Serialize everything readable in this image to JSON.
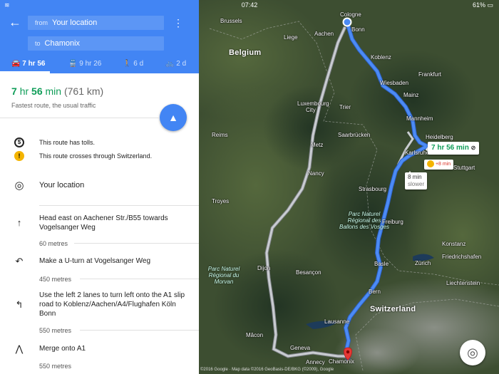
{
  "status": {
    "time": "07:42",
    "battery": "61%"
  },
  "route_form": {
    "from_label": "from",
    "from_value": "Your location",
    "to_label": "to",
    "to_value": "Chamonix"
  },
  "modes": [
    {
      "icon": "car-icon",
      "glyph": "🚘",
      "label": "7 hr 56",
      "selected": true
    },
    {
      "icon": "transit-icon",
      "glyph": "🚆",
      "label": "9 hr 26",
      "selected": false
    },
    {
      "icon": "walk-icon",
      "glyph": "🚶",
      "label": "6 d",
      "selected": false
    },
    {
      "icon": "bike-icon",
      "glyph": "🚲",
      "label": "2 d",
      "selected": false
    }
  ],
  "summary": {
    "hours": "7",
    "hr_label": "hr",
    "minutes": "56",
    "min_label": "min",
    "distance": "(761 km)",
    "subtitle": "Fastest route, the usual traffic"
  },
  "notes": [
    {
      "icon": "toll-icon",
      "text": "This route has tolls."
    },
    {
      "icon": "warning-icon",
      "text": "This route crosses through Switzerland."
    }
  ],
  "origin": {
    "icon": "my-location-icon",
    "text": "Your location"
  },
  "steps": [
    {
      "icon": "straight-arrow-icon",
      "glyph": "↑",
      "text": "Head east on Aachener Str./B55 towards Vogelsanger Weg",
      "distance": "60 metres"
    },
    {
      "icon": "u-turn-icon",
      "glyph": "↶",
      "text": "Make a U-turn at Vogelsanger Weg",
      "distance": "450 metres"
    },
    {
      "icon": "turn-left-icon",
      "glyph": "↰",
      "text": "Use the left 2 lanes to turn left onto the A1 slip road to Koblenz/Aachen/A4/Flughafen Köln Bonn",
      "distance": "550 metres"
    },
    {
      "icon": "merge-icon",
      "glyph": "⋀",
      "text": "Merge onto A1",
      "distance": "550 metres"
    }
  ],
  "map": {
    "countries": [
      "Belgium",
      "Switzerland"
    ],
    "cities": [
      "Cologne",
      "Bonn",
      "Brussels",
      "Liege",
      "Aachen",
      "Koblenz",
      "Frankfurt",
      "Wiesbaden",
      "Mainz",
      "Luxembourg",
      "City",
      "Trier",
      "Mannheim",
      "Heidelberg",
      "Reims",
      "Saarbrücken",
      "Metz",
      "Karlsruhe",
      "Stuttgart",
      "Nancy",
      "Troyes",
      "Strasbourg",
      "Freiburg",
      "Konstanz",
      "Friedrichshafen",
      "Basle",
      "Zürich",
      "Dijon",
      "Besançon",
      "Bern",
      "Liechtenstein",
      "Lausanne",
      "Geneva",
      "Annecy",
      "Chamonix",
      "Mâcon"
    ],
    "regions": [
      "Parc Naturel Régional des Ballons des Vosges",
      "Parc Naturel Régional du Morvan"
    ],
    "route_callout": "7 hr 56 min",
    "incident_label": "+8 min",
    "alt_callout": {
      "time": "8 min",
      "sub": "slower"
    },
    "attribution": "©2016 Google · Map data ©2016 GeoBasis-DE/BKG (©2009), Google"
  },
  "colors": {
    "header_blue": "#4285f4",
    "route_blue": "#4c8bf5",
    "alt_route": "#c9ccd1",
    "green": "#0f9d58"
  }
}
